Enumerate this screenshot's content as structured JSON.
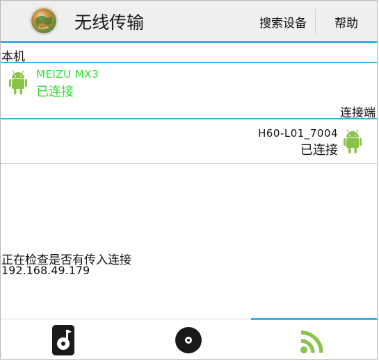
{
  "header": {
    "title": "无线传输",
    "search_devices": "搜索设备",
    "help": "帮助"
  },
  "local": {
    "section_label": "本机",
    "device_name": "MEIZU MX3",
    "device_status": "已连接",
    "accent_color": "#33dd33"
  },
  "remote": {
    "section_label": "连接端",
    "device_name": "H60-L01_7004",
    "device_status": "已连接"
  },
  "status": {
    "message": "正在检查是否有传入连接",
    "ip": "192.168.49.179"
  },
  "tabs": [
    {
      "icon": "music-player-icon",
      "active": false
    },
    {
      "icon": "disc-icon",
      "active": false
    },
    {
      "icon": "wifi-signal-icon",
      "active": true
    }
  ],
  "colors": {
    "accent": "#35b3e6",
    "android": "#8bc34a"
  }
}
